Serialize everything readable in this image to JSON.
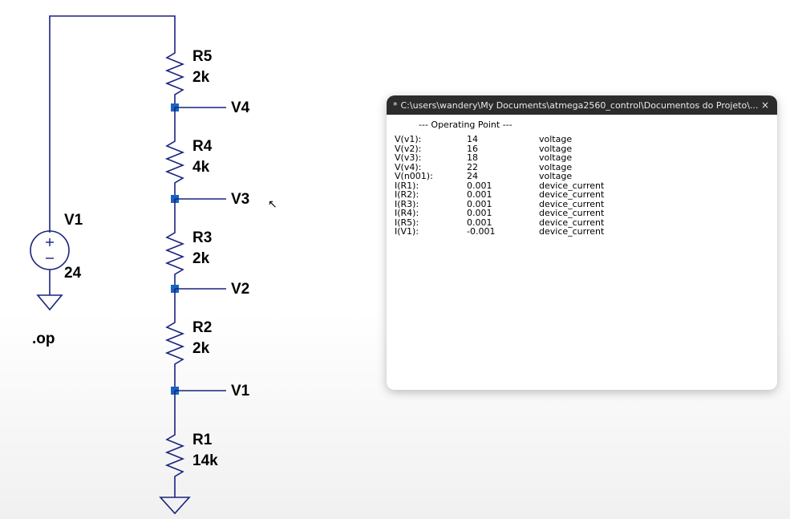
{
  "schematic": {
    "source": {
      "name": "V1",
      "value": "24"
    },
    "directive": ".op",
    "resistors": {
      "R5": {
        "name": "R5",
        "value": "2k"
      },
      "R4": {
        "name": "R4",
        "value": "4k"
      },
      "R3": {
        "name": "R3",
        "value": "2k"
      },
      "R2": {
        "name": "R2",
        "value": "2k"
      },
      "R1": {
        "name": "R1",
        "value": "14k"
      }
    },
    "nodes": {
      "V4": "V4",
      "V3": "V3",
      "V2": "V2",
      "V1": "V1"
    }
  },
  "output_window": {
    "title": "C:\\users\\wandery\\My Documents\\atmega2560_control\\Documentos do Projeto\\...",
    "dirty_indicator": "*",
    "header": "--- Operating Point ---",
    "rows": [
      {
        "name": "V(v1):",
        "value": "14",
        "type": "voltage"
      },
      {
        "name": "V(v2):",
        "value": "16",
        "type": "voltage"
      },
      {
        "name": "V(v3):",
        "value": "18",
        "type": "voltage"
      },
      {
        "name": "V(v4):",
        "value": "22",
        "type": "voltage"
      },
      {
        "name": "V(n001):",
        "value": "24",
        "type": "voltage"
      },
      {
        "name": "I(R1):",
        "value": "0.001",
        "type": "device_current"
      },
      {
        "name": "I(R2):",
        "value": "0.001",
        "type": "device_current"
      },
      {
        "name": "I(R3):",
        "value": "0.001",
        "type": "device_current"
      },
      {
        "name": "I(R4):",
        "value": "0.001",
        "type": "device_current"
      },
      {
        "name": "I(R5):",
        "value": "0.001",
        "type": "device_current"
      },
      {
        "name": "I(V1):",
        "value": "-0.001",
        "type": "device_current"
      }
    ]
  },
  "close_glyph": "×"
}
